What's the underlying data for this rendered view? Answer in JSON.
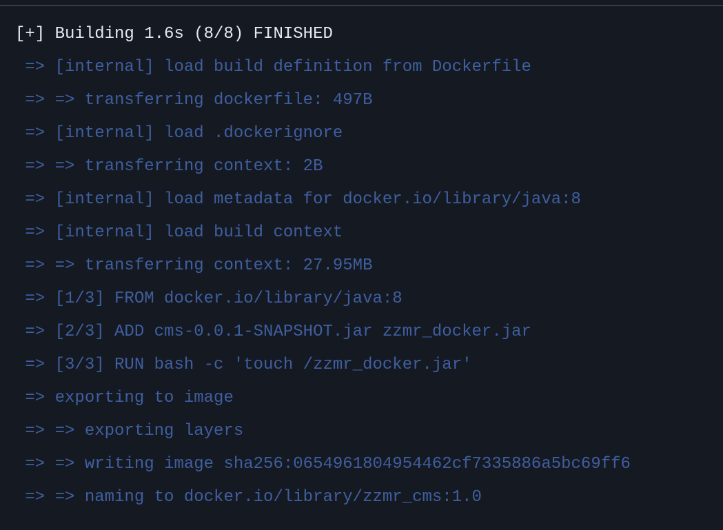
{
  "terminal": {
    "lines": [
      "[+] Building 1.6s (8/8) FINISHED",
      " => [internal] load build definition from Dockerfile",
      " => => transferring dockerfile: 497B",
      " => [internal] load .dockerignore",
      " => => transferring context: 2B",
      " => [internal] load metadata for docker.io/library/java:8",
      " => [internal] load build context",
      " => => transferring context: 27.95MB",
      " => [1/3] FROM docker.io/library/java:8",
      " => [2/3] ADD cms-0.0.1-SNAPSHOT.jar zzmr_docker.jar",
      " => [3/3] RUN bash -c 'touch /zzmr_docker.jar'",
      " => exporting to image",
      " => => exporting layers",
      " => => writing image sha256:0654961804954462cf7335886a5bc69ff6",
      " => => naming to docker.io/library/zzmr_cms:1.0"
    ]
  },
  "colors": {
    "background": "#151922",
    "header_text": "#e7e9ee",
    "body_text": "#3f5fa0",
    "divider": "#343b4a"
  }
}
